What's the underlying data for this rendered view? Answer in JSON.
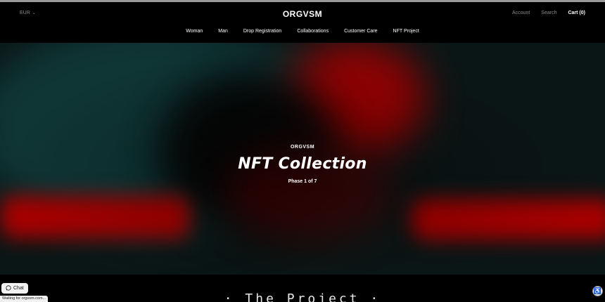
{
  "header": {
    "currency": "EUR",
    "logo": "ORGVSM",
    "account": "Account",
    "search": "Search",
    "cart": "Cart (0)"
  },
  "nav": {
    "items": [
      {
        "label": "Woman"
      },
      {
        "label": "Man"
      },
      {
        "label": "Drop Registration"
      },
      {
        "label": "Collaborations"
      },
      {
        "label": "Customer Care"
      },
      {
        "label": "NFT Project"
      }
    ]
  },
  "hero": {
    "brand": "ORGVSM",
    "title": "NFT Collection",
    "phase": "Phase 1 of 7"
  },
  "project": {
    "heading": "· The Project ·"
  },
  "widgets": {
    "chat_label": "Chat",
    "chat_icon": "whatsapp-icon",
    "accessibility_icon": "accessibility-icon"
  },
  "status": {
    "text": "Waiting for orgvsm.com..."
  },
  "colors": {
    "hero_red": "#c00000",
    "hero_teal": "#0f3a3a",
    "header_bg": "#000000"
  }
}
